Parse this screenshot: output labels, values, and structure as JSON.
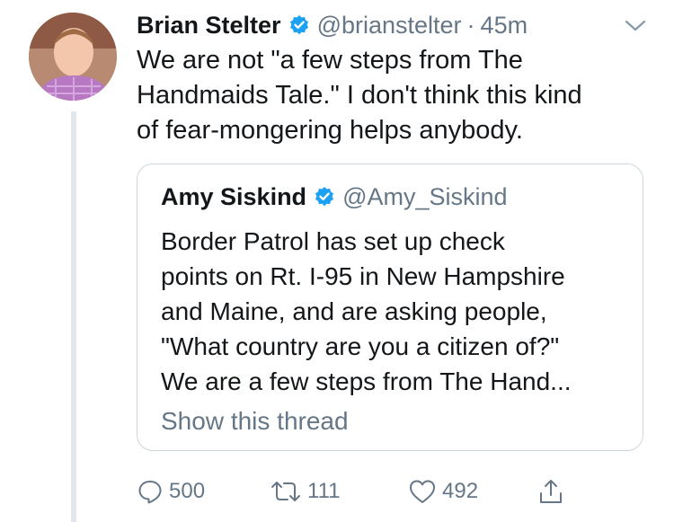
{
  "tweet": {
    "author_name": "Brian Stelter",
    "author_handle": "@brianstelter",
    "separator": "·",
    "time": "45m",
    "text_lines": [
      "We are not \"a few steps from The",
      "Handmaids Tale.\" I don't think this kind",
      "of fear-mongering helps anybody."
    ],
    "avatar_icon": "person-avatar"
  },
  "quoted": {
    "author_name": "Amy Siskind",
    "author_handle": "@Amy_Siskind",
    "text_lines": [
      "Border Patrol has set up check",
      "points on Rt. I-95 in New Hampshire",
      "and Maine, and are asking people,",
      "\"What country are you a citizen of?\"",
      "We are a few steps from The Hand..."
    ],
    "show_thread": "Show this thread"
  },
  "actions": {
    "replies": "500",
    "retweets": "111",
    "likes": "492"
  },
  "colors": {
    "verified": "#1da1f2",
    "muted": "#657786",
    "border": "#ccd6dd",
    "thread_line": "#e1e8ed"
  }
}
